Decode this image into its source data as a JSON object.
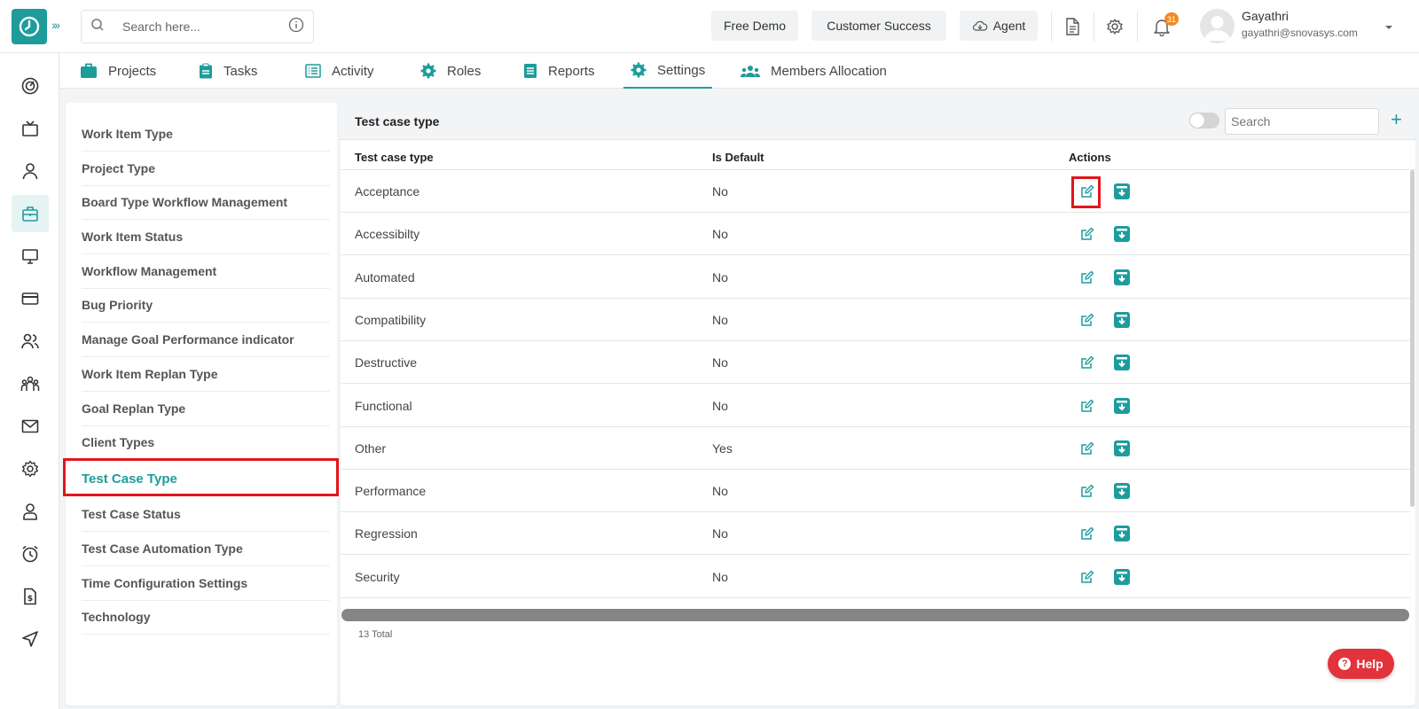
{
  "header": {
    "search_placeholder": "Search here...",
    "buttons": [
      "Free Demo",
      "Customer Success",
      "Agent"
    ],
    "notification_count": "31",
    "user": {
      "name": "Gayathri",
      "email": "gayathri@snovasys.com"
    }
  },
  "tabs": [
    "Projects",
    "Tasks",
    "Activity",
    "Roles",
    "Reports",
    "Settings",
    "Members Allocation"
  ],
  "settings_menu": [
    "Work Item Type",
    "Project Type",
    "Board Type Workflow Management",
    "Work Item Status",
    "Workflow Management",
    "Bug Priority",
    "Manage Goal Performance indicator",
    "Work Item Replan Type",
    "Goal Replan Type",
    "Client Types",
    "Test Case Type",
    "Test Case Status",
    "Test Case Automation Type",
    "Time Configuration Settings",
    "Technology"
  ],
  "panel": {
    "title": "Test case type",
    "search_placeholder": "Search",
    "columns": [
      "Test case type",
      "Is Default",
      "Actions"
    ],
    "rows": [
      {
        "type": "Acceptance",
        "is_default": "No"
      },
      {
        "type": "Accessibilty",
        "is_default": "No"
      },
      {
        "type": "Automated",
        "is_default": "No"
      },
      {
        "type": "Compatibility",
        "is_default": "No"
      },
      {
        "type": "Destructive",
        "is_default": "No"
      },
      {
        "type": "Functional",
        "is_default": "No"
      },
      {
        "type": "Other",
        "is_default": "Yes"
      },
      {
        "type": "Performance",
        "is_default": "No"
      },
      {
        "type": "Regression",
        "is_default": "No"
      },
      {
        "type": "Security",
        "is_default": "No"
      }
    ],
    "total": "13 Total"
  },
  "help_label": "Help",
  "colors": {
    "accent": "#1e9c9c",
    "highlight": "#e2141d",
    "help": "#e2333d",
    "badge": "#f08a24"
  }
}
